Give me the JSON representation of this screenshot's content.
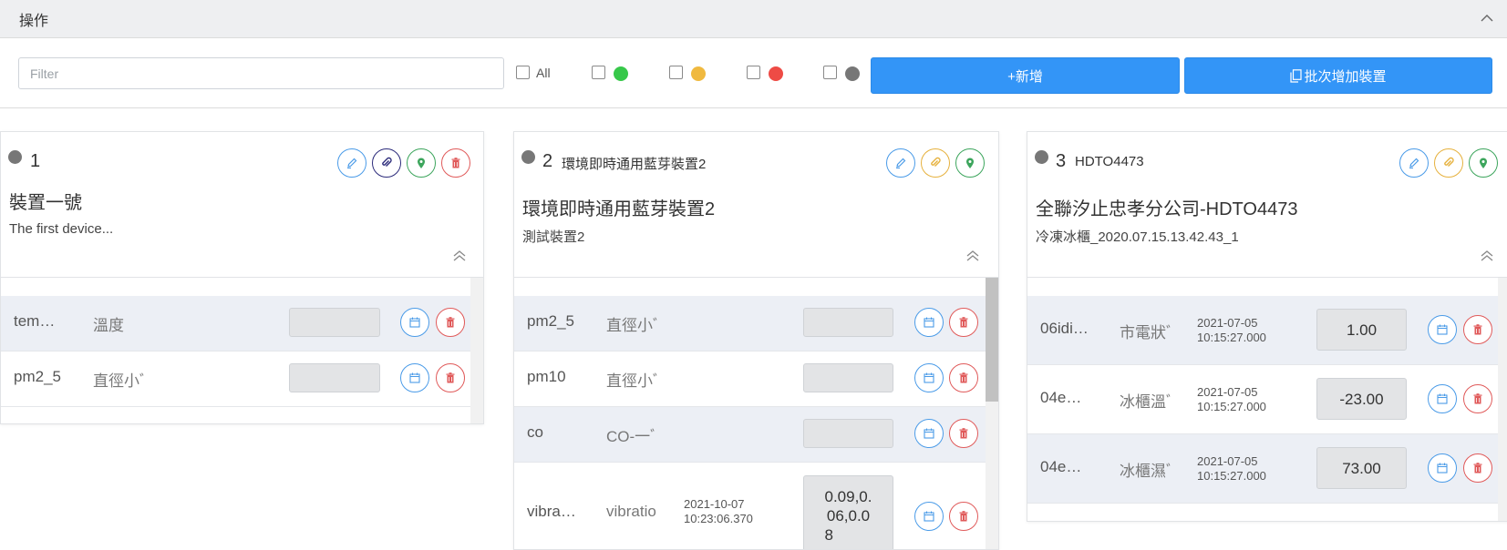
{
  "header": {
    "title": "操作"
  },
  "filter": {
    "placeholder": "Filter",
    "all_label": "All",
    "status_colors": [
      "#37c84a",
      "#f0b93f",
      "#ee4b45",
      "#777777"
    ]
  },
  "buttons": {
    "add_label": "+新增",
    "batch_label": "批次增加裝置"
  },
  "cards": [
    {
      "number": "1",
      "subtitle": "",
      "name": "裝置一號",
      "description": "The first device...",
      "actions": [
        "edit-icon",
        "link-icon",
        "location-icon",
        "trash-icon"
      ],
      "rows": [
        {
          "key": "tem…",
          "name": "溫度",
          "time": "",
          "value": ""
        },
        {
          "key": "pm2_5",
          "name": "直徑小ﾞ",
          "time": "",
          "value": ""
        }
      ]
    },
    {
      "number": "2",
      "subtitle": "環境即時通用藍芽裝置2",
      "name": "環境即時通用藍芽裝置2",
      "description": "測試裝置2",
      "actions": [
        "edit-icon",
        "link-icon",
        "location-icon"
      ],
      "rows": [
        {
          "key": "pm2_5",
          "name": "直徑小ﾞ",
          "time": "",
          "value": ""
        },
        {
          "key": "pm10",
          "name": "直徑小ﾞ",
          "time": "",
          "value": ""
        },
        {
          "key": "co",
          "name": "CO-一ﾞ",
          "time": "",
          "value": ""
        },
        {
          "key": "vibra…",
          "name": "vibratio",
          "time": "2021-10-07 10:23:06.370",
          "time_a": "2021-10-07",
          "time_b": "10:23:06.370",
          "value": "0.09,0.06,0.08",
          "value_lines": [
            "0.09,0.",
            "06,0.0",
            "8"
          ]
        }
      ]
    },
    {
      "number": "3",
      "subtitle": "HDTO4473",
      "name": "全聯汐止忠孝分公司-HDTO4473",
      "description": "冷凍冰櫃_2020.07.15.13.42.43_1",
      "actions": [
        "edit-icon",
        "link-icon",
        "location-icon"
      ],
      "rows": [
        {
          "key": "06idi…",
          "name": "市電狀ﾞ",
          "time_a": "2021-07-05",
          "time_b": "10:15:27.000",
          "value": "1.00"
        },
        {
          "key": "04e…",
          "name": "冰櫃溫ﾞ",
          "time_a": "2021-07-05",
          "time_b": "10:15:27.000",
          "value": "-23.00"
        },
        {
          "key": "04e…",
          "name": "冰櫃濕ﾞ",
          "time_a": "2021-07-05",
          "time_b": "10:15:27.000",
          "value": "73.00"
        }
      ]
    }
  ]
}
